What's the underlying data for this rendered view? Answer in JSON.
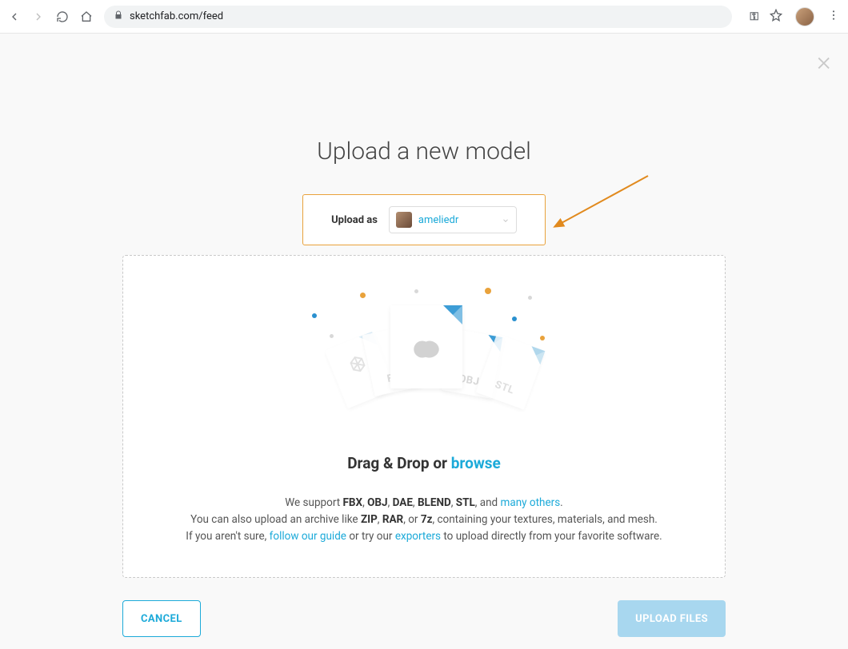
{
  "browser": {
    "url_display": "sketchfab.com/feed",
    "key_icon_glyph": "⚿"
  },
  "modal": {
    "title": "Upload a new model",
    "upload_as_label": "Upload as",
    "selected_user": "ameliedr"
  },
  "dropzone": {
    "drag_prefix": "Drag & Drop or ",
    "browse": "browse",
    "support_line1_a": "We support ",
    "formats": {
      "fbx": "FBX",
      "obj": "OBJ",
      "dae": "DAE",
      "blend": "BLEND",
      "stl": "STL"
    },
    "support_line1_b": ", and ",
    "many_others": "many others",
    "period1": ".",
    "line2_a": "You can also upload an archive like ",
    "archives": {
      "zip": "ZIP",
      "rar": "RAR",
      "sevenz": "7z"
    },
    "line2_b": ", containing your textures, materials, and mesh.",
    "line3_a": "If you aren't sure, ",
    "guide_link": "follow our guide",
    "line3_b": " or try our ",
    "exporters_link": "exporters",
    "line3_c": " to upload directly from your favorite software."
  },
  "file_labels": {
    "fbx": "FBX",
    "obj": "OBJ",
    "stl": "STL"
  },
  "footer": {
    "cancel": "CANCEL",
    "upload": "UPLOAD FILES"
  },
  "sep": {
    "comma": ", ",
    "comma_or": ", or "
  }
}
